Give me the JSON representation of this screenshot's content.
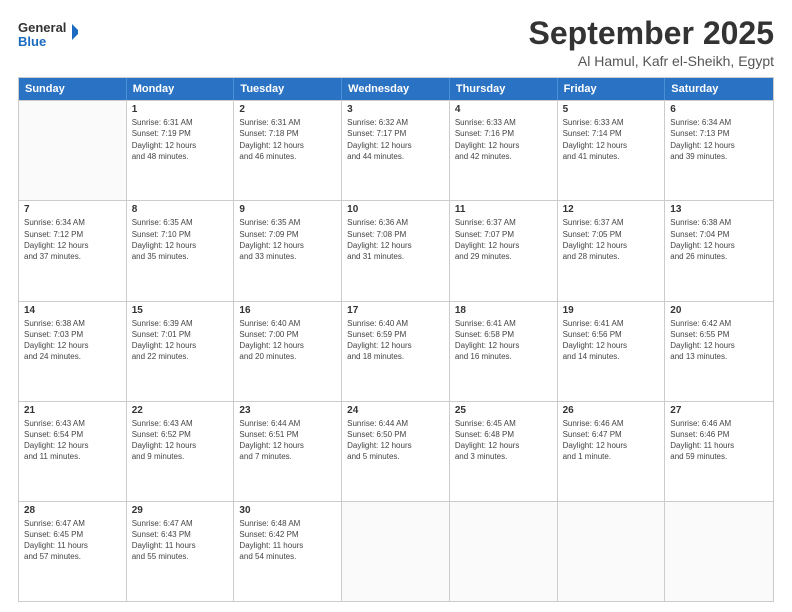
{
  "logo": {
    "line1": "General",
    "line2": "Blue"
  },
  "header": {
    "month": "September 2025",
    "location": "Al Hamul, Kafr el-Sheikh, Egypt"
  },
  "days": [
    "Sunday",
    "Monday",
    "Tuesday",
    "Wednesday",
    "Thursday",
    "Friday",
    "Saturday"
  ],
  "weeks": [
    [
      {
        "day": "",
        "lines": []
      },
      {
        "day": "1",
        "lines": [
          "Sunrise: 6:31 AM",
          "Sunset: 7:19 PM",
          "Daylight: 12 hours",
          "and 48 minutes."
        ]
      },
      {
        "day": "2",
        "lines": [
          "Sunrise: 6:31 AM",
          "Sunset: 7:18 PM",
          "Daylight: 12 hours",
          "and 46 minutes."
        ]
      },
      {
        "day": "3",
        "lines": [
          "Sunrise: 6:32 AM",
          "Sunset: 7:17 PM",
          "Daylight: 12 hours",
          "and 44 minutes."
        ]
      },
      {
        "day": "4",
        "lines": [
          "Sunrise: 6:33 AM",
          "Sunset: 7:16 PM",
          "Daylight: 12 hours",
          "and 42 minutes."
        ]
      },
      {
        "day": "5",
        "lines": [
          "Sunrise: 6:33 AM",
          "Sunset: 7:14 PM",
          "Daylight: 12 hours",
          "and 41 minutes."
        ]
      },
      {
        "day": "6",
        "lines": [
          "Sunrise: 6:34 AM",
          "Sunset: 7:13 PM",
          "Daylight: 12 hours",
          "and 39 minutes."
        ]
      }
    ],
    [
      {
        "day": "7",
        "lines": [
          "Sunrise: 6:34 AM",
          "Sunset: 7:12 PM",
          "Daylight: 12 hours",
          "and 37 minutes."
        ]
      },
      {
        "day": "8",
        "lines": [
          "Sunrise: 6:35 AM",
          "Sunset: 7:10 PM",
          "Daylight: 12 hours",
          "and 35 minutes."
        ]
      },
      {
        "day": "9",
        "lines": [
          "Sunrise: 6:35 AM",
          "Sunset: 7:09 PM",
          "Daylight: 12 hours",
          "and 33 minutes."
        ]
      },
      {
        "day": "10",
        "lines": [
          "Sunrise: 6:36 AM",
          "Sunset: 7:08 PM",
          "Daylight: 12 hours",
          "and 31 minutes."
        ]
      },
      {
        "day": "11",
        "lines": [
          "Sunrise: 6:37 AM",
          "Sunset: 7:07 PM",
          "Daylight: 12 hours",
          "and 29 minutes."
        ]
      },
      {
        "day": "12",
        "lines": [
          "Sunrise: 6:37 AM",
          "Sunset: 7:05 PM",
          "Daylight: 12 hours",
          "and 28 minutes."
        ]
      },
      {
        "day": "13",
        "lines": [
          "Sunrise: 6:38 AM",
          "Sunset: 7:04 PM",
          "Daylight: 12 hours",
          "and 26 minutes."
        ]
      }
    ],
    [
      {
        "day": "14",
        "lines": [
          "Sunrise: 6:38 AM",
          "Sunset: 7:03 PM",
          "Daylight: 12 hours",
          "and 24 minutes."
        ]
      },
      {
        "day": "15",
        "lines": [
          "Sunrise: 6:39 AM",
          "Sunset: 7:01 PM",
          "Daylight: 12 hours",
          "and 22 minutes."
        ]
      },
      {
        "day": "16",
        "lines": [
          "Sunrise: 6:40 AM",
          "Sunset: 7:00 PM",
          "Daylight: 12 hours",
          "and 20 minutes."
        ]
      },
      {
        "day": "17",
        "lines": [
          "Sunrise: 6:40 AM",
          "Sunset: 6:59 PM",
          "Daylight: 12 hours",
          "and 18 minutes."
        ]
      },
      {
        "day": "18",
        "lines": [
          "Sunrise: 6:41 AM",
          "Sunset: 6:58 PM",
          "Daylight: 12 hours",
          "and 16 minutes."
        ]
      },
      {
        "day": "19",
        "lines": [
          "Sunrise: 6:41 AM",
          "Sunset: 6:56 PM",
          "Daylight: 12 hours",
          "and 14 minutes."
        ]
      },
      {
        "day": "20",
        "lines": [
          "Sunrise: 6:42 AM",
          "Sunset: 6:55 PM",
          "Daylight: 12 hours",
          "and 13 minutes."
        ]
      }
    ],
    [
      {
        "day": "21",
        "lines": [
          "Sunrise: 6:43 AM",
          "Sunset: 6:54 PM",
          "Daylight: 12 hours",
          "and 11 minutes."
        ]
      },
      {
        "day": "22",
        "lines": [
          "Sunrise: 6:43 AM",
          "Sunset: 6:52 PM",
          "Daylight: 12 hours",
          "and 9 minutes."
        ]
      },
      {
        "day": "23",
        "lines": [
          "Sunrise: 6:44 AM",
          "Sunset: 6:51 PM",
          "Daylight: 12 hours",
          "and 7 minutes."
        ]
      },
      {
        "day": "24",
        "lines": [
          "Sunrise: 6:44 AM",
          "Sunset: 6:50 PM",
          "Daylight: 12 hours",
          "and 5 minutes."
        ]
      },
      {
        "day": "25",
        "lines": [
          "Sunrise: 6:45 AM",
          "Sunset: 6:48 PM",
          "Daylight: 12 hours",
          "and 3 minutes."
        ]
      },
      {
        "day": "26",
        "lines": [
          "Sunrise: 6:46 AM",
          "Sunset: 6:47 PM",
          "Daylight: 12 hours",
          "and 1 minute."
        ]
      },
      {
        "day": "27",
        "lines": [
          "Sunrise: 6:46 AM",
          "Sunset: 6:46 PM",
          "Daylight: 11 hours",
          "and 59 minutes."
        ]
      }
    ],
    [
      {
        "day": "28",
        "lines": [
          "Sunrise: 6:47 AM",
          "Sunset: 6:45 PM",
          "Daylight: 11 hours",
          "and 57 minutes."
        ]
      },
      {
        "day": "29",
        "lines": [
          "Sunrise: 6:47 AM",
          "Sunset: 6:43 PM",
          "Daylight: 11 hours",
          "and 55 minutes."
        ]
      },
      {
        "day": "30",
        "lines": [
          "Sunrise: 6:48 AM",
          "Sunset: 6:42 PM",
          "Daylight: 11 hours",
          "and 54 minutes."
        ]
      },
      {
        "day": "",
        "lines": []
      },
      {
        "day": "",
        "lines": []
      },
      {
        "day": "",
        "lines": []
      },
      {
        "day": "",
        "lines": []
      }
    ]
  ]
}
